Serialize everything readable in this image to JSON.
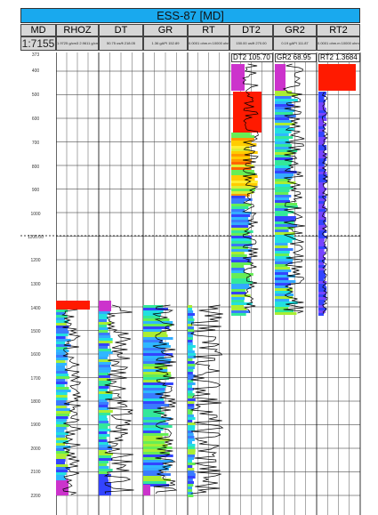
{
  "title": "ESS-87 [MD]",
  "columns": [
    {
      "name": "MD"
    },
    {
      "name": "RHOZ"
    },
    {
      "name": "DT"
    },
    {
      "name": "GR"
    },
    {
      "name": "RT"
    },
    {
      "name": "DT2"
    },
    {
      "name": "GR2"
    },
    {
      "name": "RT2"
    }
  ],
  "scale": "1:7155",
  "subheaders": {
    "rhoz": "1.9725 g/cm3 2.9611 g/cm3",
    "dt": "50.75 us/ft 218.05",
    "gr": "1.36 gAPI 152.89",
    "rt": "0.0001 ohm.m 10000 ohm.m",
    "dt2": "150.00 us/ft 270.00",
    "gr2": "0.19 gAPI 111.87",
    "rt2": "0.0001 ohm.m 10000 ohm.m"
  },
  "chips": {
    "dt2": "DT2 105.70",
    "gr2": "GR2 68.95",
    "rt2": "RT2 1.3684"
  },
  "depth_labels": [
    "373",
    "400",
    "500",
    "600",
    "700",
    "800",
    "900",
    "1000",
    "1100.00",
    "1200",
    "1300",
    "1400",
    "1500",
    "1600",
    "1700",
    "1800",
    "1900",
    "2000",
    "2100",
    "2200"
  ],
  "colors": {
    "header_blue": "#19a9ee",
    "cap_magenta": "#cc33cc",
    "cap_red": "#ff1a00"
  }
}
